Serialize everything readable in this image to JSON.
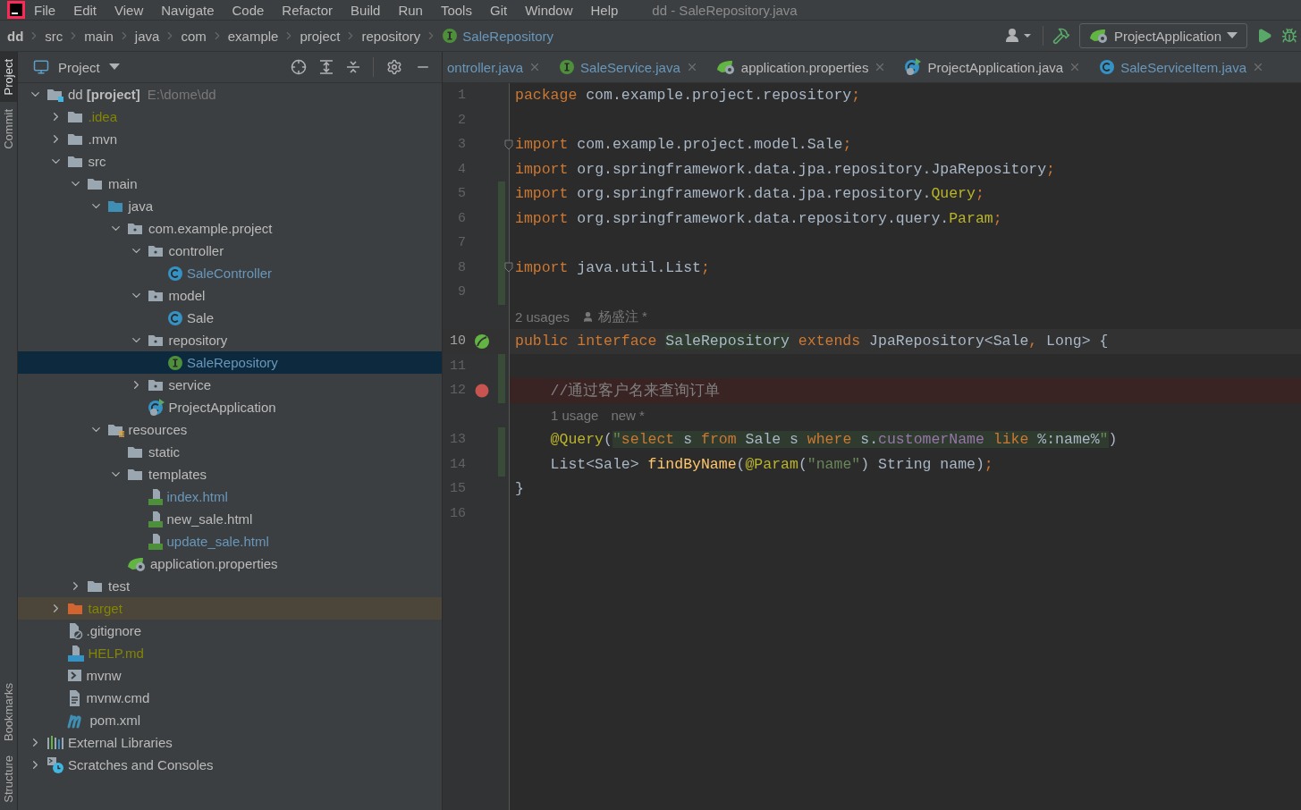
{
  "menu": {
    "items": [
      "File",
      "Edit",
      "View",
      "Navigate",
      "Code",
      "Refactor",
      "Build",
      "Run",
      "Tools",
      "Git",
      "Window",
      "Help"
    ],
    "title": "dd - SaleRepository.java"
  },
  "breadcrumbs": [
    {
      "label": "dd",
      "kind": "root"
    },
    {
      "label": "src",
      "kind": "folder"
    },
    {
      "label": "main",
      "kind": "folder"
    },
    {
      "label": "java",
      "kind": "folder"
    },
    {
      "label": "com",
      "kind": "folder"
    },
    {
      "label": "example",
      "kind": "folder"
    },
    {
      "label": "project",
      "kind": "folder"
    },
    {
      "label": "repository",
      "kind": "folder"
    },
    {
      "label": "SaleRepository",
      "kind": "interface"
    }
  ],
  "toolbar": {
    "run_config": "ProjectApplication"
  },
  "side_tabs_top": [
    {
      "label": "Project",
      "selected": true
    },
    {
      "label": "Commit",
      "selected": false
    }
  ],
  "side_tabs_bottom": [
    {
      "label": "Bookmarks",
      "selected": false
    },
    {
      "label": "Structure",
      "selected": false
    }
  ],
  "project_panel": {
    "title": "Project",
    "tree": [
      {
        "label": "dd **[project]**",
        "path": "E:\\dome\\dd",
        "kind": "module",
        "color": "#bbbbbb",
        "selected": false,
        "expanded": true,
        "children": [
          {
            "label": ".idea",
            "kind": "folder",
            "color": "#848504",
            "selected": false,
            "expanded": false
          },
          {
            "label": ".mvn",
            "kind": "folder",
            "color": "#bbbbbb",
            "selected": false,
            "expanded": false
          },
          {
            "label": "src",
            "kind": "folder",
            "color": "#bbbbbb",
            "selected": false,
            "expanded": true,
            "children": [
              {
                "label": "main",
                "kind": "folder",
                "color": "#bbbbbb",
                "selected": false,
                "expanded": true,
                "children": [
                  {
                    "label": "java",
                    "kind": "source",
                    "color": "#bbbbbb",
                    "selected": false,
                    "expanded": true,
                    "children": [
                      {
                        "label": "com.example.project",
                        "kind": "package",
                        "color": "#bbbbbb",
                        "selected": false,
                        "expanded": true,
                        "children": [
                          {
                            "label": "controller",
                            "kind": "package",
                            "color": "#bbbbbb",
                            "selected": false,
                            "expanded": true,
                            "children": [
                              {
                                "label": "SaleController",
                                "kind": "class",
                                "color": "#6897bb",
                                "selected": false
                              }
                            ]
                          },
                          {
                            "label": "model",
                            "kind": "package",
                            "color": "#bbbbbb",
                            "selected": false,
                            "expanded": true,
                            "children": [
                              {
                                "label": "Sale",
                                "kind": "class",
                                "color": "#bbbbbb",
                                "selected": false
                              }
                            ]
                          },
                          {
                            "label": "repository",
                            "kind": "package",
                            "color": "#bbbbbb",
                            "selected": false,
                            "expanded": true,
                            "children": [
                              {
                                "label": "SaleRepository",
                                "kind": "interface",
                                "color": "#6897bb",
                                "selected": true
                              }
                            ]
                          },
                          {
                            "label": "service",
                            "kind": "package",
                            "color": "#bbbbbb",
                            "selected": false,
                            "expanded": false
                          },
                          {
                            "label": "ProjectApplication",
                            "kind": "spring-class",
                            "color": "#bbbbbb",
                            "selected": false
                          }
                        ]
                      }
                    ]
                  },
                  {
                    "label": "resources",
                    "kind": "resources",
                    "color": "#bbbbbb",
                    "selected": false,
                    "expanded": true,
                    "children": [
                      {
                        "label": "static",
                        "kind": "folder",
                        "color": "#bbbbbb",
                        "selected": false
                      },
                      {
                        "label": "templates",
                        "kind": "folder",
                        "color": "#bbbbbb",
                        "selected": false,
                        "expanded": true,
                        "children": [
                          {
                            "label": "index.html",
                            "kind": "html",
                            "color": "#6897bb",
                            "selected": false
                          },
                          {
                            "label": "new_sale.html",
                            "kind": "html",
                            "color": "#bbbbbb",
                            "selected": false
                          },
                          {
                            "label": "update_sale.html",
                            "kind": "html",
                            "color": "#6897bb",
                            "selected": false
                          }
                        ]
                      },
                      {
                        "label": "application.properties",
                        "kind": "properties",
                        "color": "#bbbbbb",
                        "selected": false
                      }
                    ]
                  }
                ]
              },
              {
                "label": "test",
                "kind": "folder",
                "color": "#bbbbbb",
                "selected": false,
                "expanded": false
              }
            ]
          },
          {
            "label": "target",
            "kind": "excluded",
            "color": "#848504",
            "selected": false,
            "highlighted": true,
            "expanded": false
          },
          {
            "label": ".gitignore",
            "kind": "gitignore",
            "color": "#bbbbbb",
            "selected": false
          },
          {
            "label": "HELP.md",
            "kind": "markdown",
            "color": "#848504",
            "selected": false
          },
          {
            "label": "mvnw",
            "kind": "script",
            "color": "#bbbbbb",
            "selected": false
          },
          {
            "label": "mvnw.cmd",
            "kind": "text",
            "color": "#bbbbbb",
            "selected": false
          },
          {
            "label": "pom.xml",
            "kind": "maven",
            "color": "#bbbbbb",
            "selected": false
          }
        ]
      },
      {
        "label": "External Libraries",
        "kind": "libraries",
        "color": "#bbbbbb",
        "selected": false,
        "expanded": false
      },
      {
        "label": "Scratches and Consoles",
        "kind": "scratches",
        "color": "#bbbbbb",
        "selected": false,
        "expanded": false
      }
    ]
  },
  "editor_tabs": [
    {
      "label": "ontroller.java",
      "kind": "none",
      "color": "#6897bb",
      "selected": false
    },
    {
      "label": "SaleService.java",
      "kind": "interface",
      "color": "#6897bb",
      "selected": false
    },
    {
      "label": "application.properties",
      "kind": "properties",
      "color": "#bbbbbb",
      "selected": false
    },
    {
      "label": "ProjectApplication.java",
      "kind": "spring-class",
      "color": "#bbbbbb",
      "selected": false
    },
    {
      "label": "SaleServiceItem.java",
      "kind": "class",
      "color": "#6897bb",
      "selected": false
    }
  ],
  "code": [
    {
      "kind": "code",
      "number": "1",
      "changed": false,
      "tokens": [
        {
          "kind": "kw",
          "text": "package"
        },
        {
          "kind": "plain",
          "text": " com.example.project.repository"
        },
        {
          "kind": "kw",
          "text": ";"
        }
      ]
    },
    {
      "kind": "code",
      "number": "2",
      "changed": false
    },
    {
      "kind": "code",
      "number": "3",
      "changed": false,
      "fold": true,
      "tokens": [
        {
          "kind": "kw",
          "text": "import"
        },
        {
          "kind": "plain",
          "text": " com.example.project.model.Sale"
        },
        {
          "kind": "kw",
          "text": ";"
        }
      ]
    },
    {
      "kind": "code",
      "number": "4",
      "changed": false,
      "tokens": [
        {
          "kind": "kw",
          "text": "import"
        },
        {
          "kind": "plain",
          "text": " org.springframework.data.jpa.repository.JpaRepository"
        },
        {
          "kind": "kw",
          "text": ";"
        }
      ]
    },
    {
      "kind": "code",
      "number": "5",
      "changed": true,
      "tokens": [
        {
          "kind": "kw",
          "text": "import"
        },
        {
          "kind": "plain",
          "text": " org.springframework.data.jpa.repository."
        },
        {
          "kind": "annot",
          "text": "Query"
        },
        {
          "kind": "kw",
          "text": ";"
        }
      ]
    },
    {
      "kind": "code",
      "number": "6",
      "changed": true,
      "tokens": [
        {
          "kind": "kw",
          "text": "import"
        },
        {
          "kind": "plain",
          "text": " org.springframework.data.repository.query."
        },
        {
          "kind": "annot",
          "text": "Param"
        },
        {
          "kind": "kw",
          "text": ";"
        }
      ]
    },
    {
      "kind": "code",
      "number": "7",
      "changed": true
    },
    {
      "kind": "code",
      "number": "8",
      "changed": true,
      "fold": true,
      "tokens": [
        {
          "kind": "kw",
          "text": "import"
        },
        {
          "kind": "plain",
          "text": " java.util.List"
        },
        {
          "kind": "kw",
          "text": ";"
        }
      ]
    },
    {
      "kind": "code",
      "number": "9",
      "changed": true
    },
    {
      "kind": "hint",
      "nested": false,
      "usages": "2 usages",
      "author": "杨盛注 *",
      "author_icon": true
    },
    {
      "kind": "code",
      "number": "10",
      "changed": false,
      "caret": true,
      "bean": true,
      "tokens": [
        {
          "kind": "kw",
          "text": "public interface "
        },
        {
          "kind": "plain",
          "text": "SaleRepository",
          "hl": true
        },
        {
          "kind": "kw",
          "text": " extends"
        },
        {
          "kind": "plain",
          "text": " JpaRepository<Sale"
        },
        {
          "kind": "kw",
          "text": ","
        },
        {
          "kind": "plain",
          "text": " Long> {"
        }
      ]
    },
    {
      "kind": "code",
      "number": "11",
      "changed": true
    },
    {
      "kind": "code",
      "number": "12",
      "changed": true,
      "breakpoint": true,
      "tokens": [
        {
          "kind": "comment",
          "text": "    //通过客户名来查询订单"
        }
      ]
    },
    {
      "kind": "hint",
      "nested": true,
      "usages": "1 usage",
      "author": "new *",
      "author_icon": false
    },
    {
      "kind": "code",
      "number": "13",
      "changed": true,
      "tokens": [
        {
          "kind": "annot",
          "text": "    @Query"
        },
        {
          "kind": "plain",
          "text": "("
        },
        {
          "kind": "string",
          "text": "\"",
          "hl": true
        },
        {
          "kind": "kw",
          "text": "select",
          "hl": true
        },
        {
          "kind": "plain",
          "text": " s ",
          "hl": true
        },
        {
          "kind": "kw",
          "text": "from",
          "hl": true
        },
        {
          "kind": "plain",
          "text": " Sale s ",
          "hl": true
        },
        {
          "kind": "kw",
          "text": "where",
          "hl": true
        },
        {
          "kind": "plain",
          "text": " s.",
          "hl": true
        },
        {
          "kind": "field",
          "text": "customerName",
          "hl": true
        },
        {
          "kind": "kw",
          "text": " like",
          "hl": true
        },
        {
          "kind": "plain",
          "text": " %:name%",
          "hl": true
        },
        {
          "kind": "string",
          "text": "\"",
          "hl": true
        },
        {
          "kind": "plain",
          "text": ")"
        }
      ]
    },
    {
      "kind": "code",
      "number": "14",
      "changed": true,
      "tokens": [
        {
          "kind": "plain",
          "text": "    List<Sale> "
        },
        {
          "kind": "method",
          "text": "findByName"
        },
        {
          "kind": "plain",
          "text": "("
        },
        {
          "kind": "annot",
          "text": "@Param"
        },
        {
          "kind": "plain",
          "text": "("
        },
        {
          "kind": "string",
          "text": "\"name\""
        },
        {
          "kind": "plain",
          "text": ") String name)"
        },
        {
          "kind": "kw",
          "text": ";"
        }
      ]
    },
    {
      "kind": "code",
      "number": "15",
      "changed": false,
      "tokens": [
        {
          "kind": "plain",
          "text": "}"
        }
      ]
    },
    {
      "kind": "code",
      "number": "16",
      "changed": false
    }
  ]
}
